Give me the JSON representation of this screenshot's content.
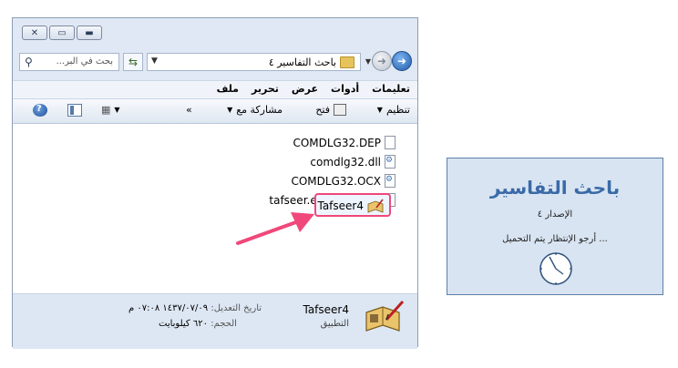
{
  "window": {
    "buttons": {
      "close": "✕",
      "maximize": "▭",
      "minimize": "▬"
    },
    "address": {
      "path": "باحث التفاسير ٤"
    },
    "search": {
      "placeholder": "بحث في البر..."
    },
    "menu": [
      "ملف",
      "تحرير",
      "عرض",
      "أدوات",
      "تعليمات"
    ],
    "toolbar": {
      "organize": "تنظيم",
      "open": "فتح",
      "share": "مشاركة مع",
      "more": "»"
    },
    "files": [
      {
        "name": "COMDLG32.DEP",
        "icon": "blank-file-icon"
      },
      {
        "name": "comdlg32.dll",
        "icon": "gear-file-icon"
      },
      {
        "name": "COMDLG32.OCX",
        "icon": "gear-file-icon"
      },
      {
        "name": "tafseer.exe.manifest",
        "icon": "blank-file-icon"
      }
    ],
    "selected_file": {
      "name": "Tafseer4",
      "icon": "book-pen-icon"
    },
    "details": {
      "name": "Tafseer4",
      "type": "التطبيق",
      "modified_label": "تاريخ التعديل:",
      "modified_value": "١٤٣٧/٠٧/٠٩ ٠٧:٠٨ م",
      "size_label": "الحجم:",
      "size_value": "٦٢٠ كيلوبايت"
    }
  },
  "splash": {
    "title": "باحث التفاسير",
    "version": "الإصدار ٤",
    "wait": "... أرجو الإنتظار يتم التحميل"
  },
  "colors": {
    "highlight_pink": "#f0487a",
    "splash_title": "#3a6aa8"
  }
}
